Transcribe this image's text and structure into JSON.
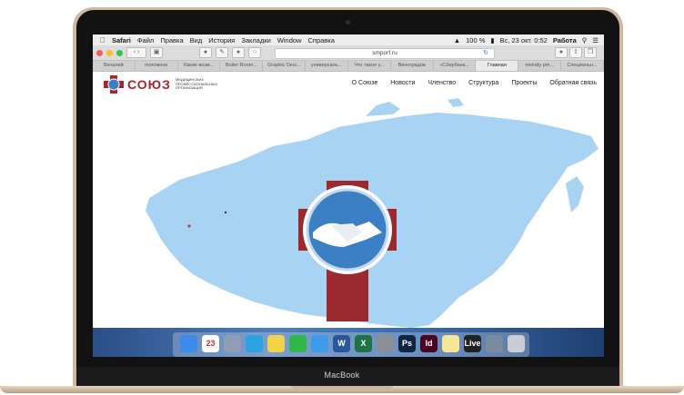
{
  "device": {
    "brand_label": "MacBook"
  },
  "menubar": {
    "apple": "",
    "app": "Safari",
    "items": [
      "Файл",
      "Правка",
      "Вид",
      "История",
      "Закладки",
      "Window",
      "Справка"
    ],
    "status": {
      "battery": "100 %",
      "datetime": "Вс, 23 окт. 0:52",
      "user": "Работа"
    }
  },
  "browser": {
    "url": "smporf.ru",
    "tabs": [
      {
        "label": "Виталий"
      },
      {
        "label": "положени"
      },
      {
        "label": "Какие возм..."
      },
      {
        "label": "Boiler Room..."
      },
      {
        "label": "Graphic Desi..."
      },
      {
        "label": "универсаль..."
      },
      {
        "label": "Что такое у..."
      },
      {
        "label": "Виноградов"
      },
      {
        "label": "«Сбербанк..."
      },
      {
        "label": "Главная",
        "active": true
      },
      {
        "label": "melody pm..."
      },
      {
        "label": "Специальн..."
      }
    ]
  },
  "site": {
    "logo_text": "СОЮЗ",
    "logo_sub": "МЕДИЦИНСКИХ ПРОФЕССИОНАЛЬНЫХ ОРГАНИЗАЦИЙ",
    "nav": [
      "О Союзе",
      "Новости",
      "Членство",
      "Структура",
      "Проекты",
      "Обратная связь"
    ]
  },
  "colors": {
    "map": "#a8d3f2",
    "cross": "#9b2a30",
    "circle": "#3b7fc4",
    "brand_red": "#a8242e"
  },
  "dock": {
    "icons": [
      {
        "name": "finder-icon",
        "color": "#3d8bea"
      },
      {
        "name": "calendar-icon",
        "color": "#ffffff",
        "label": "23"
      },
      {
        "name": "launchpad-icon",
        "color": "#8f9cb6"
      },
      {
        "name": "telegram-icon",
        "color": "#2aa3e0"
      },
      {
        "name": "notes-icon",
        "color": "#f2d44a"
      },
      {
        "name": "facetime-icon",
        "color": "#2fb84a"
      },
      {
        "name": "safari-icon",
        "color": "#3d9be9"
      },
      {
        "name": "word-icon",
        "color": "#2b579a",
        "label": "W"
      },
      {
        "name": "excel-icon",
        "color": "#207245",
        "label": "X"
      },
      {
        "name": "preferences-icon",
        "color": "#8b8e94"
      },
      {
        "name": "photoshop-icon",
        "color": "#0b2743",
        "label": "Ps"
      },
      {
        "name": "indesign-icon",
        "color": "#49021f",
        "label": "Id"
      },
      {
        "name": "stickies-icon",
        "color": "#f6e69a"
      },
      {
        "name": "ableton-live-icon",
        "color": "#222222",
        "label": "Live"
      },
      {
        "name": "preview-icon",
        "color": "#7a8aa0"
      },
      {
        "name": "trash-icon",
        "color": "#c9ced6"
      }
    ]
  }
}
